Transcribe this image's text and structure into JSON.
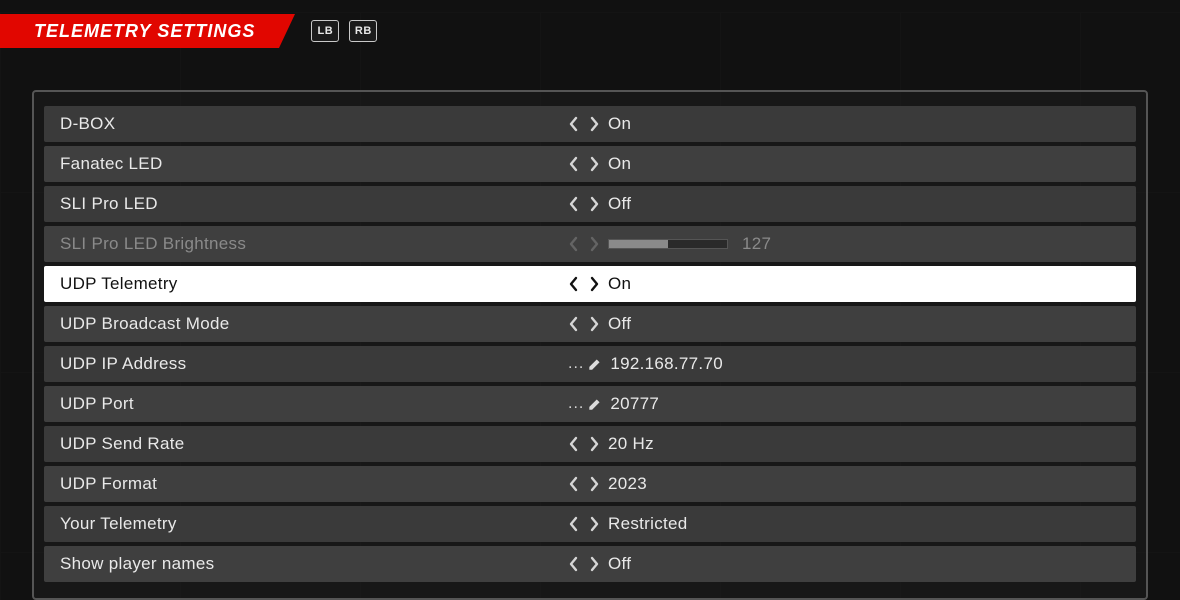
{
  "header": {
    "title": "TELEMETRY SETTINGS",
    "bumper_left": "LB",
    "bumper_right": "RB"
  },
  "rows": [
    {
      "id": "dbox",
      "label": "D-BOX",
      "kind": "toggle",
      "value": "On"
    },
    {
      "id": "fanatec-led",
      "label": "Fanatec LED",
      "kind": "toggle",
      "value": "On"
    },
    {
      "id": "sli-pro-led",
      "label": "SLI Pro LED",
      "kind": "toggle",
      "value": "Off"
    },
    {
      "id": "sli-pro-brightness",
      "label": "SLI Pro LED Brightness",
      "kind": "slider",
      "value": "127",
      "disabled": true,
      "fill_pct": 50
    },
    {
      "id": "udp-telemetry",
      "label": "UDP Telemetry",
      "kind": "toggle",
      "value": "On",
      "selected": true
    },
    {
      "id": "udp-broadcast",
      "label": "UDP Broadcast Mode",
      "kind": "toggle",
      "value": "Off"
    },
    {
      "id": "udp-ip",
      "label": "UDP IP Address",
      "kind": "edit",
      "value": "192.168.77.70"
    },
    {
      "id": "udp-port",
      "label": "UDP Port",
      "kind": "edit",
      "value": "20777"
    },
    {
      "id": "udp-send-rate",
      "label": "UDP Send Rate",
      "kind": "toggle",
      "value": "20 Hz"
    },
    {
      "id": "udp-format",
      "label": "UDP Format",
      "kind": "toggle",
      "value": "2023"
    },
    {
      "id": "your-telemetry",
      "label": "Your Telemetry",
      "kind": "toggle",
      "value": "Restricted"
    },
    {
      "id": "show-player-names",
      "label": "Show player names",
      "kind": "toggle",
      "value": "Off"
    }
  ]
}
